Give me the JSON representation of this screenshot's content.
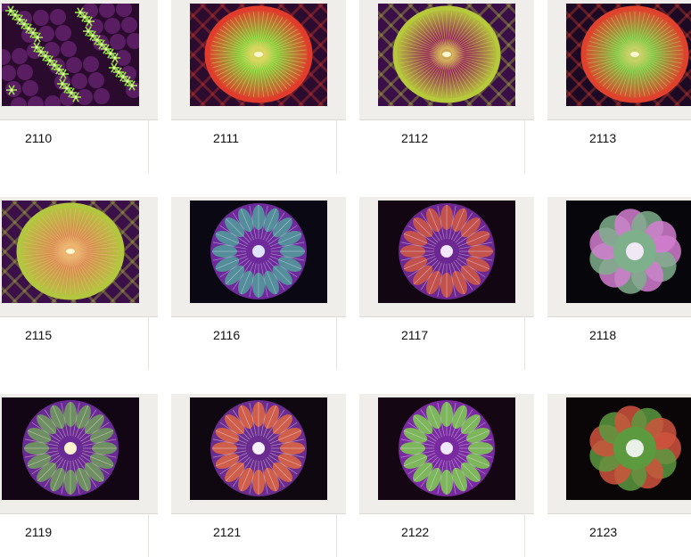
{
  "gallery": {
    "items": [
      {
        "id": "2110",
        "coral": "star-polyp",
        "colors": {
          "bg": "#2a0b2e",
          "a": "#9be34b",
          "b": "#c92db8",
          "c": "#7a2a86"
        }
      },
      {
        "id": "2111",
        "coral": "fungia",
        "colors": {
          "bg": "#2b0c2f",
          "a": "#7ed03a",
          "b": "#e13b2c",
          "c": "#f0d86a"
        }
      },
      {
        "id": "2112",
        "coral": "fungia",
        "colors": {
          "bg": "#3a0e46",
          "a": "#8e1e5a",
          "b": "#b6c93b",
          "c": "#e2d25a"
        }
      },
      {
        "id": "2113",
        "coral": "fungia",
        "colors": {
          "bg": "#1c0a24",
          "a": "#79c845",
          "b": "#e0412c",
          "c": "#d8d36e"
        }
      },
      {
        "id": "2115",
        "coral": "fungia",
        "colors": {
          "bg": "#3b0f47",
          "a": "#d98a52",
          "b": "#b2c73f",
          "c": "#f2c07a"
        }
      },
      {
        "id": "2116",
        "coral": "scoly",
        "colors": {
          "bg": "#0a0812",
          "a": "#6e2a9a",
          "b": "#4fa09a",
          "c": "#dfe3ff"
        }
      },
      {
        "id": "2117",
        "coral": "scoly",
        "colors": {
          "bg": "#120612",
          "a": "#6c2790",
          "b": "#d25a42",
          "c": "#f4e6ff"
        }
      },
      {
        "id": "2118",
        "coral": "lobo",
        "colors": {
          "bg": "#07060a",
          "a": "#7fb08c",
          "b": "#d37ed0",
          "c": "#f0e8f4"
        }
      },
      {
        "id": "2119",
        "coral": "scoly",
        "colors": {
          "bg": "#120614",
          "a": "#6a2a96",
          "b": "#6fa05a",
          "c": "#fff2cf"
        }
      },
      {
        "id": "2121",
        "coral": "scoly",
        "colors": {
          "bg": "#100810",
          "a": "#6b2c8f",
          "b": "#e0683f",
          "c": "#f7f0ff"
        }
      },
      {
        "id": "2122",
        "coral": "scoly",
        "colors": {
          "bg": "#140612",
          "a": "#7a2aa0",
          "b": "#7ecf4f",
          "c": "#f0e8ff"
        }
      },
      {
        "id": "2123",
        "coral": "lobo",
        "colors": {
          "bg": "#0a0608",
          "a": "#5b9a3f",
          "b": "#d0533d",
          "c": "#e9f0e8"
        }
      }
    ]
  }
}
